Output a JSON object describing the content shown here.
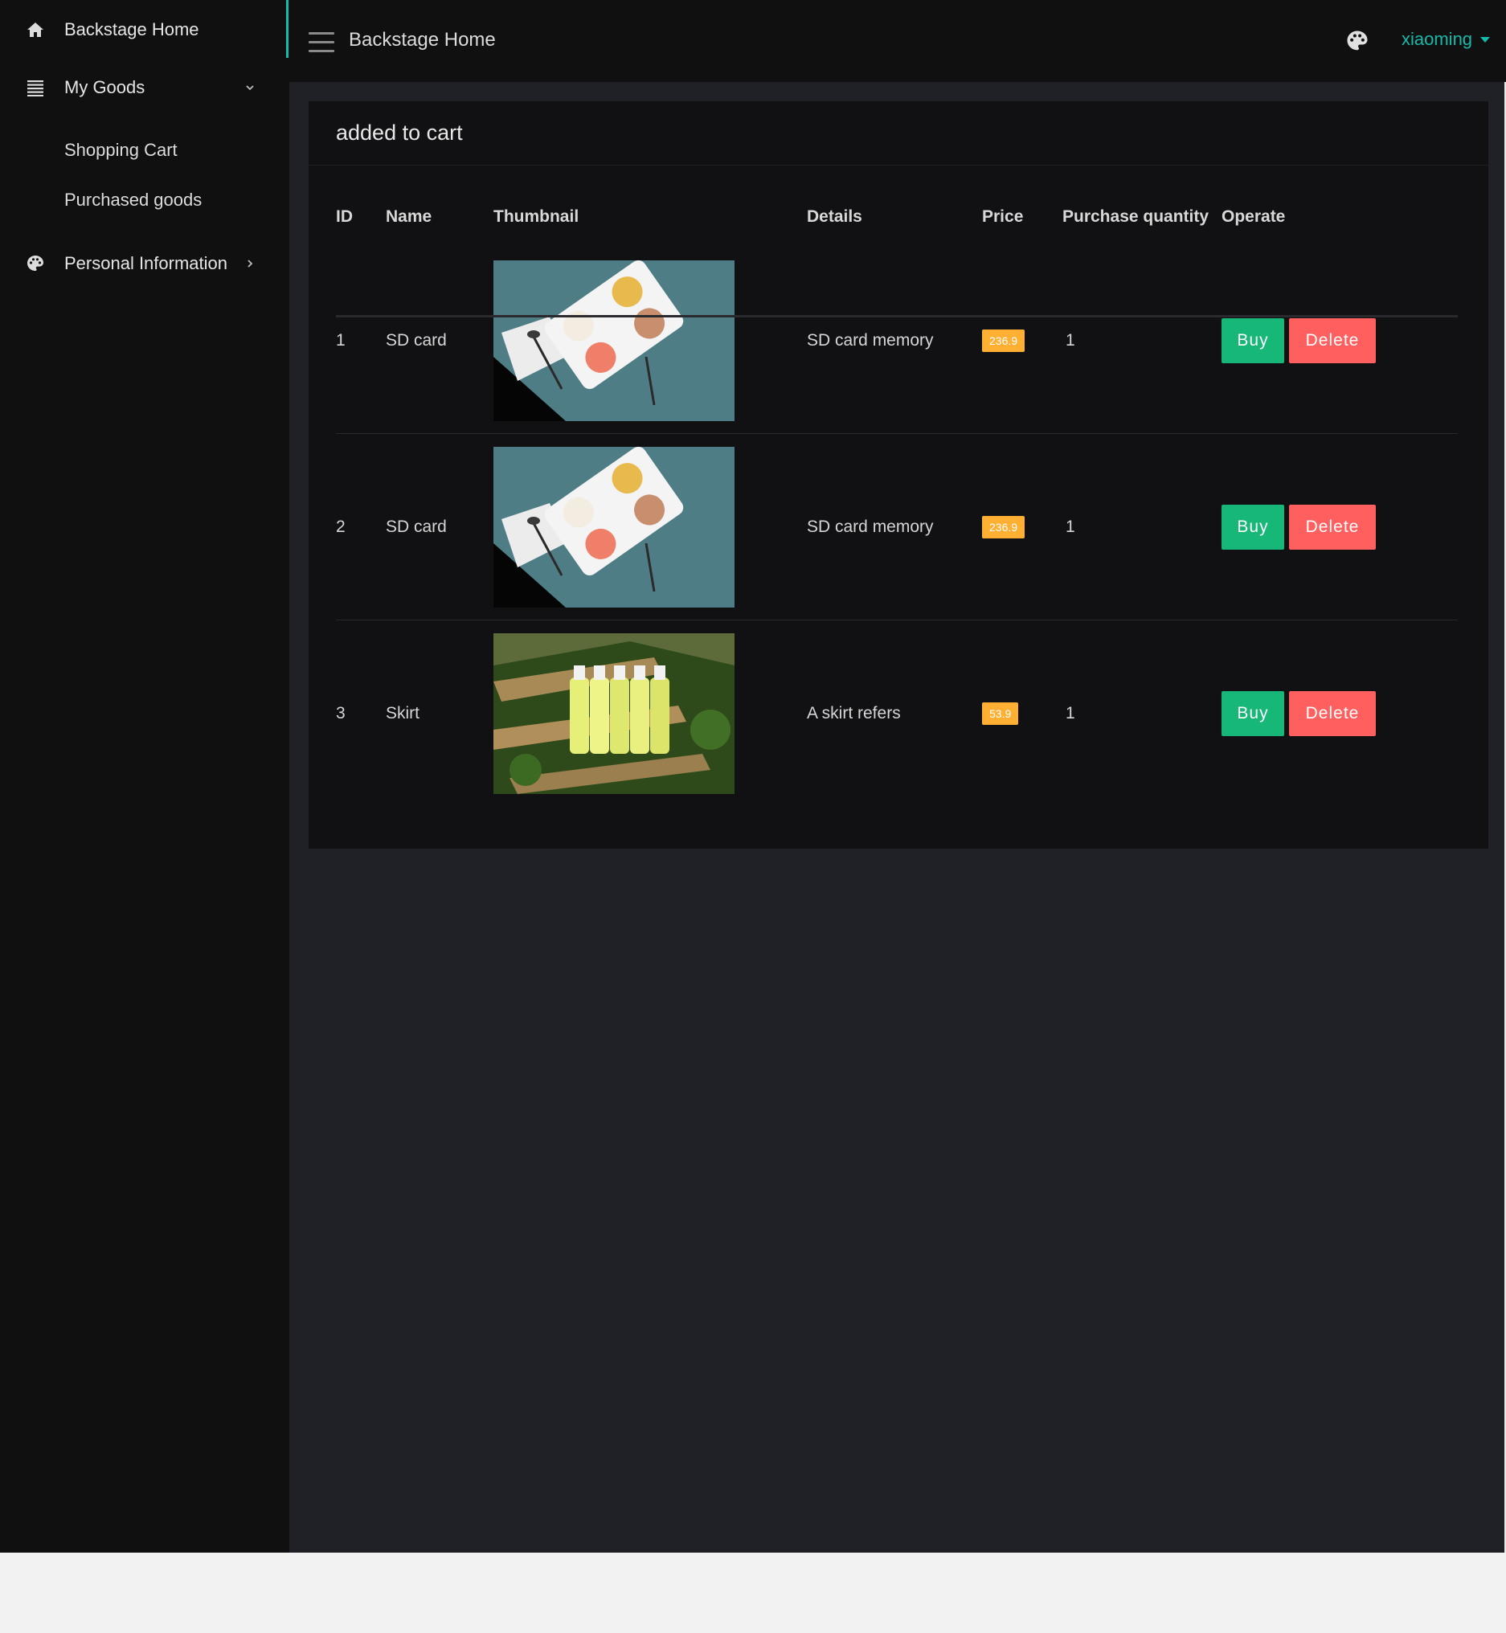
{
  "sidebar": {
    "items": [
      {
        "label": "Backstage Home",
        "icon": "home-icon"
      },
      {
        "label": "My Goods",
        "icon": "list-icon"
      },
      {
        "label": "Shopping Cart"
      },
      {
        "label": "Purchased goods"
      },
      {
        "label": "Personal Information",
        "icon": "palette-icon"
      }
    ]
  },
  "header": {
    "title": "Backstage Home",
    "username": "xiaoming"
  },
  "card": {
    "title": "added to cart"
  },
  "table": {
    "headers": [
      "ID",
      "Name",
      "Thumbnail",
      "Details",
      "Price",
      "Purchase quantity",
      "Operate"
    ],
    "rows": [
      {
        "id": "1",
        "name": "SD card",
        "details": "SD card memory",
        "price": "236.9",
        "qty": "1",
        "buy": "Buy",
        "delete": "Delete",
        "thumb": "ice-cream"
      },
      {
        "id": "2",
        "name": "SD card",
        "details": "SD card memory",
        "price": "236.9",
        "qty": "1",
        "buy": "Buy",
        "delete": "Delete",
        "thumb": "ice-cream"
      },
      {
        "id": "3",
        "name": "Skirt",
        "details": "A skirt refers",
        "price": "53.9",
        "qty": "1",
        "buy": "Buy",
        "delete": "Delete",
        "thumb": "lemonade"
      }
    ]
  },
  "colors": {
    "accent": "#16baaa",
    "buy": "#16b777",
    "delete": "#ff5f5e",
    "price_badge": "#ffb033"
  }
}
